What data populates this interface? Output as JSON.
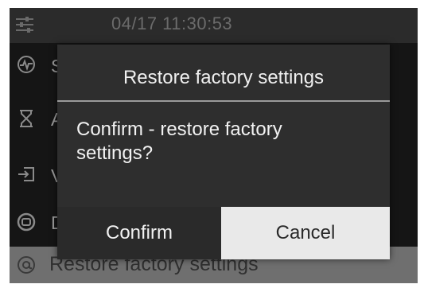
{
  "status_bar": {
    "datetime": "04/17 11:30:53",
    "menu_icon": "sliders-icon"
  },
  "menu": {
    "items": [
      {
        "icon": "waveform-icon",
        "visible_text": "S"
      },
      {
        "icon": "hourglass-icon",
        "visible_text": "A"
      },
      {
        "icon": "sign-in-icon",
        "visible_text": "V"
      },
      {
        "icon": "shield-icon",
        "visible_text": "D"
      },
      {
        "icon": "at-sign-icon",
        "visible_text": "Restore factory settings",
        "selected": true
      }
    ]
  },
  "dialog": {
    "title": "Restore factory settings",
    "message": "Confirm - restore factory settings?",
    "confirm_label": "Confirm",
    "cancel_label": "Cancel",
    "focused_button": "Cancel"
  }
}
